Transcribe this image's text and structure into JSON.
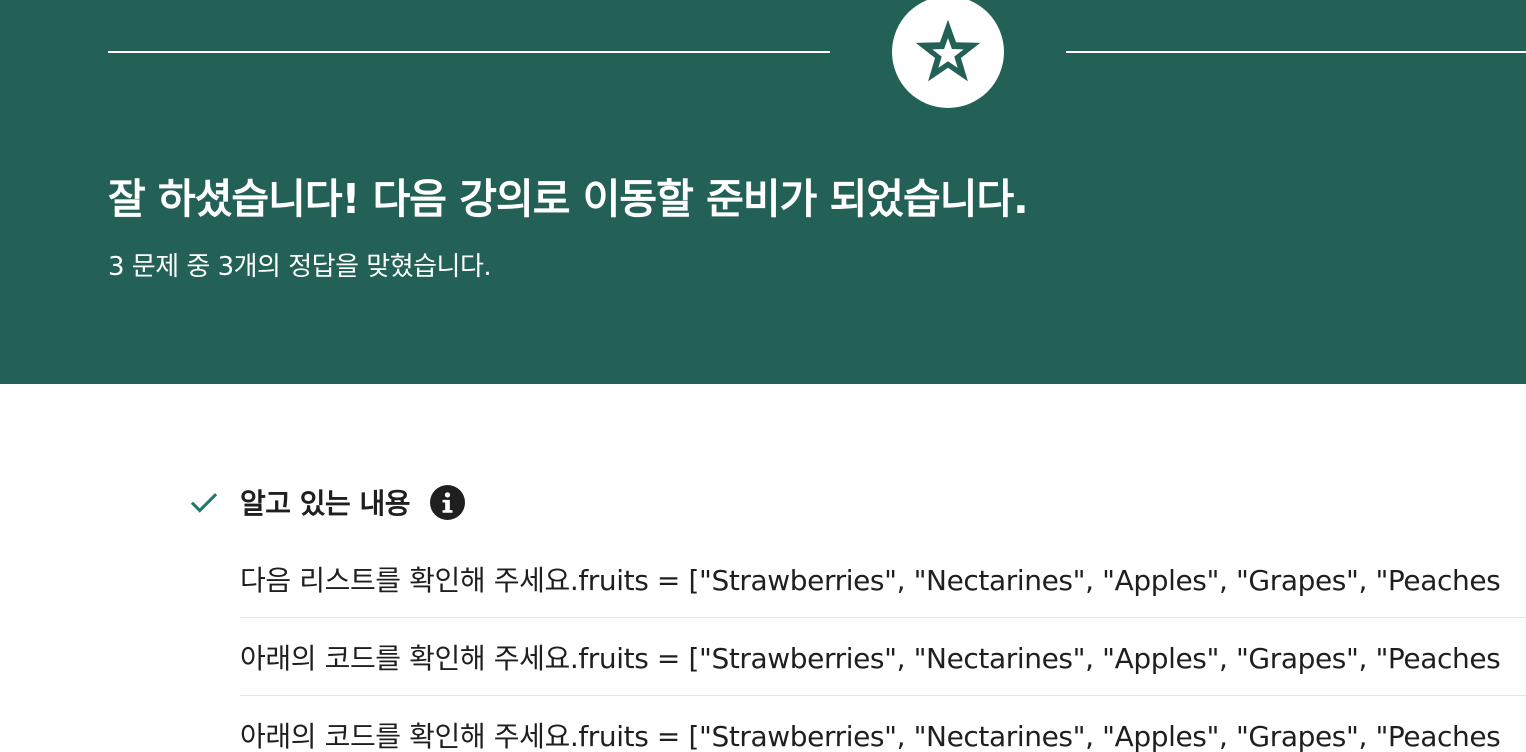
{
  "banner": {
    "background_color": "#236156",
    "badge_icon": "star-icon",
    "headline": "잘 하셨습니다! 다음 강의로 이동할 준비가 되었습니다.",
    "score_text": "3 문제 중 3개의 정답을 맞혔습니다."
  },
  "known_section": {
    "check_icon": "check-icon",
    "check_color": "#1f7a6b",
    "title": "알고 있는 내용",
    "info_icon": "info-icon",
    "questions": [
      {
        "text": "다음 리스트를 확인해 주세요.fruits = [\"Strawberries\", \"Nectarines\", \"Apples\", \"Grapes\", \"Peaches"
      },
      {
        "text": "아래의 코드를 확인해 주세요.fruits = [\"Strawberries\", \"Nectarines\", \"Apples\", \"Grapes\", \"Peaches"
      },
      {
        "text": "아래의 코드를 확인해 주세요.fruits = [\"Strawberries\", \"Nectarines\", \"Apples\", \"Grapes\", \"Peaches"
      }
    ]
  }
}
